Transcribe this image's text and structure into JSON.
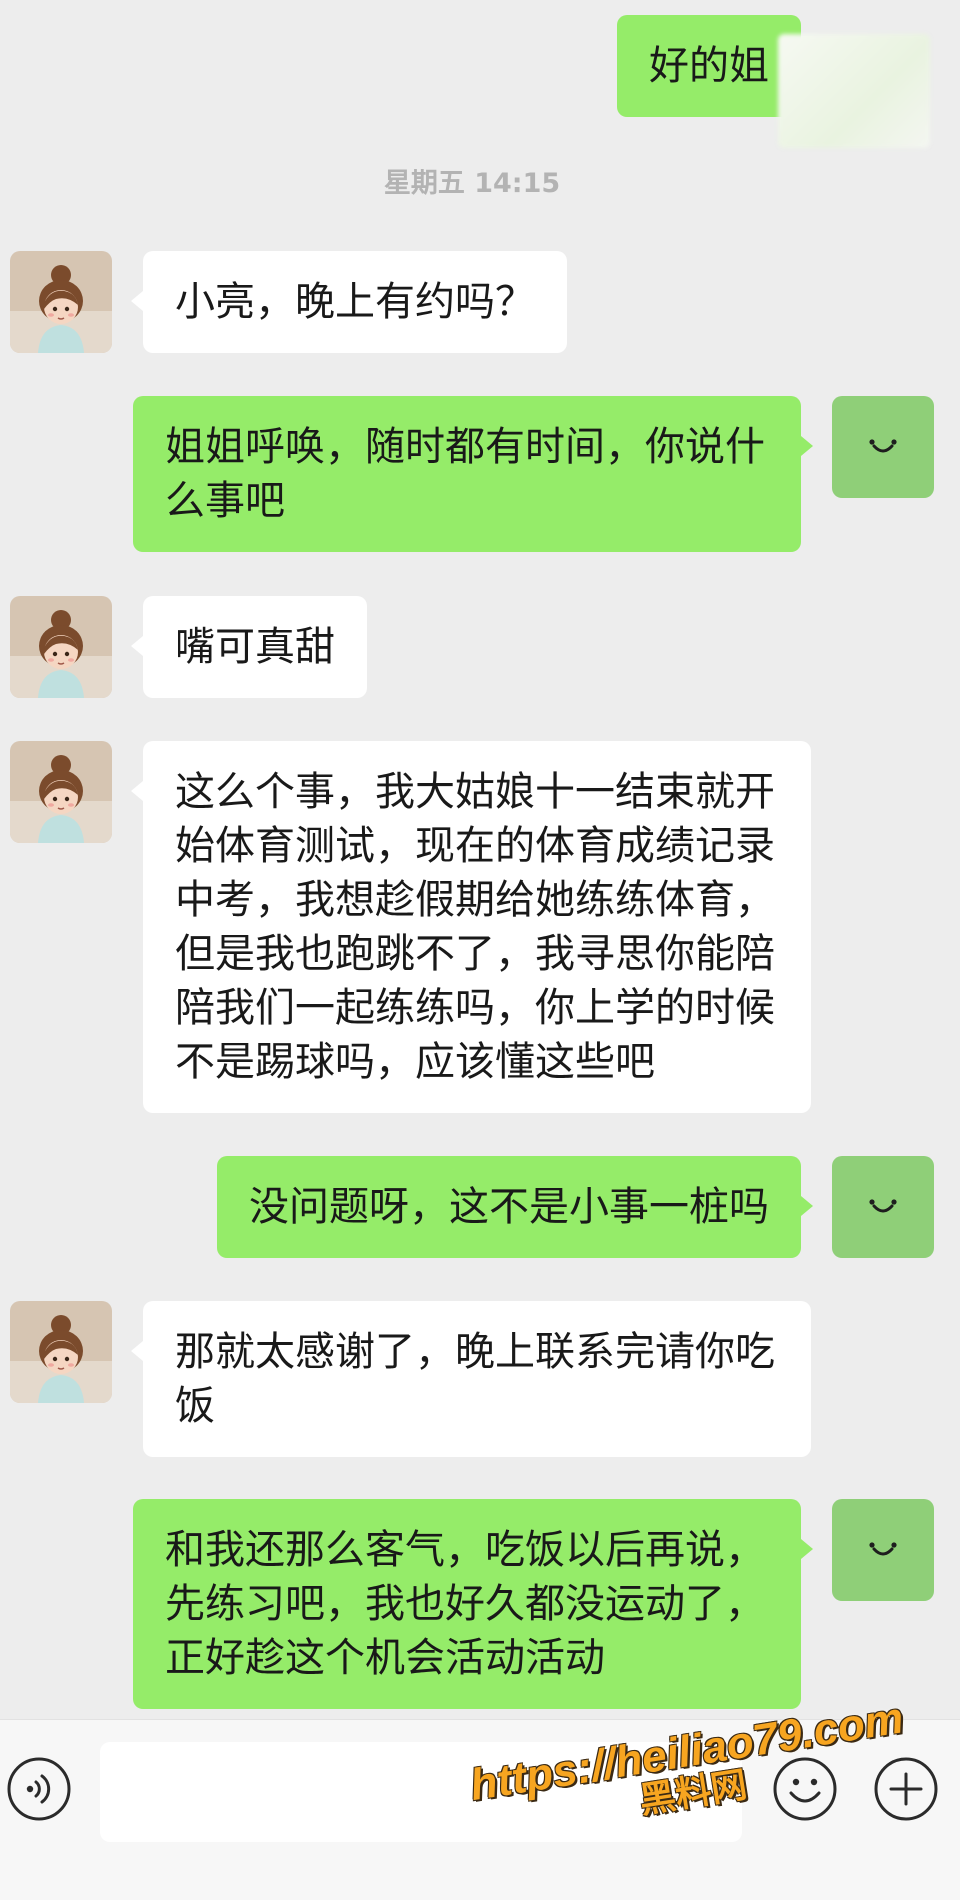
{
  "chat": {
    "timestamp": "星期五 14:15",
    "messages": [
      {
        "outgoing": true,
        "text": "好的姐"
      },
      {
        "outgoing": false,
        "text": "小亮，晚上有约吗？"
      },
      {
        "outgoing": true,
        "text": "姐姐呼唤，随时都有时间，你说什么事吧"
      },
      {
        "outgoing": false,
        "text": "嘴可真甜"
      },
      {
        "outgoing": false,
        "text": "这么个事，我大姑娘十一结束就开始体育测试，现在的体育成绩记录中考，我想趁假期给她练练体育，但是我也跑跳不了，我寻思你能陪陪我们一起练练吗，你上学的时候不是踢球吗，应该懂这些吧"
      },
      {
        "outgoing": true,
        "text": "没问题呀，这不是小事一桩吗"
      },
      {
        "outgoing": false,
        "text": "那就太感谢了，晚上联系完请你吃饭"
      },
      {
        "outgoing": true,
        "text": "和我还那么客气，吃饭以后再说，先练习吧，我也好久都没运动了，正好趁这个机会活动活动"
      }
    ]
  },
  "input_bar": {
    "message_input_value": "",
    "icons": {
      "voice": "voice-icon",
      "emoji": "emoji-icon",
      "more": "plus-icon"
    }
  },
  "watermark": {
    "url": "https://heiliao79.com",
    "site_name": "黑料网"
  },
  "colors": {
    "chat_background": "#ededed",
    "outgoing_bubble": "#95ec69",
    "incoming_bubble": "#ffffff",
    "self_avatar": "#8fcf78",
    "watermark_text": "#f7a520"
  }
}
